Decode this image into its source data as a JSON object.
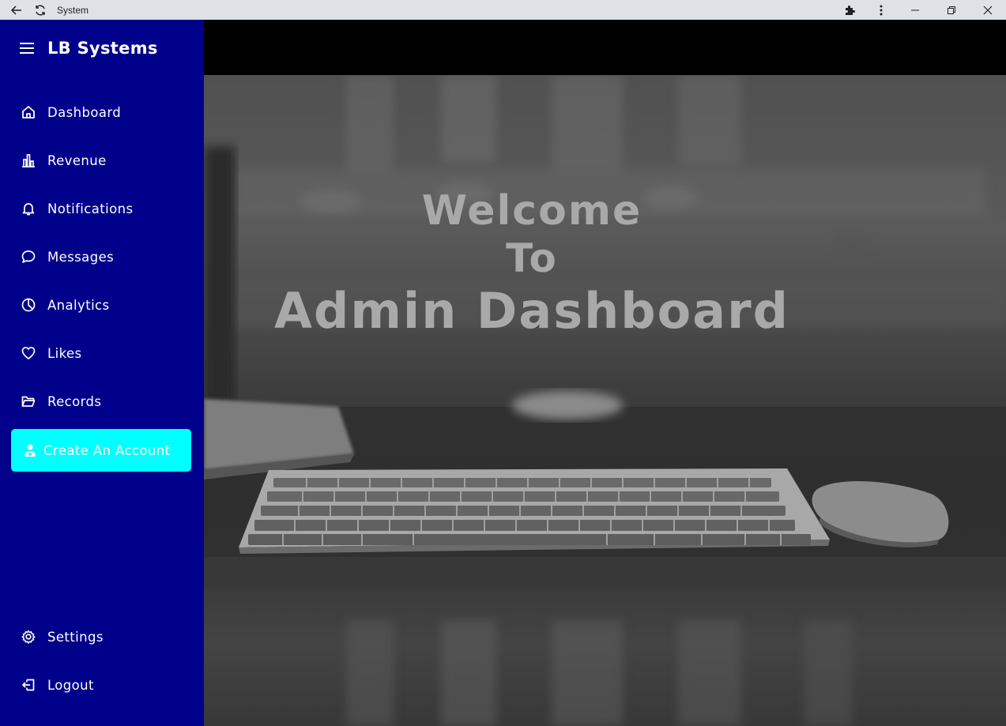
{
  "browser": {
    "title": "System"
  },
  "sidebar": {
    "brand": "LB Systems",
    "items": [
      {
        "label": "Dashboard",
        "icon": "home-icon"
      },
      {
        "label": "Revenue",
        "icon": "bar-chart-icon"
      },
      {
        "label": "Notifications",
        "icon": "bell-icon"
      },
      {
        "label": "Messages",
        "icon": "chat-icon"
      },
      {
        "label": "Analytics",
        "icon": "pie-chart-icon"
      },
      {
        "label": "Likes",
        "icon": "heart-icon"
      },
      {
        "label": "Records",
        "icon": "folder-icon"
      }
    ],
    "create_button": {
      "label": "Create An Account",
      "icon": "user-icon"
    },
    "bottom_items": [
      {
        "label": "Settings",
        "icon": "gear-icon"
      },
      {
        "label": "Logout",
        "icon": "logout-icon"
      }
    ],
    "colors": {
      "background": "#00008b",
      "create_button": "#00ffff",
      "text": "#ffffff"
    }
  },
  "hero": {
    "line1": "Welcome",
    "line2": "To",
    "line3": "Admin Dashboard",
    "text_color": "#a9a9a9"
  },
  "topbar": {
    "background": "#000000"
  }
}
